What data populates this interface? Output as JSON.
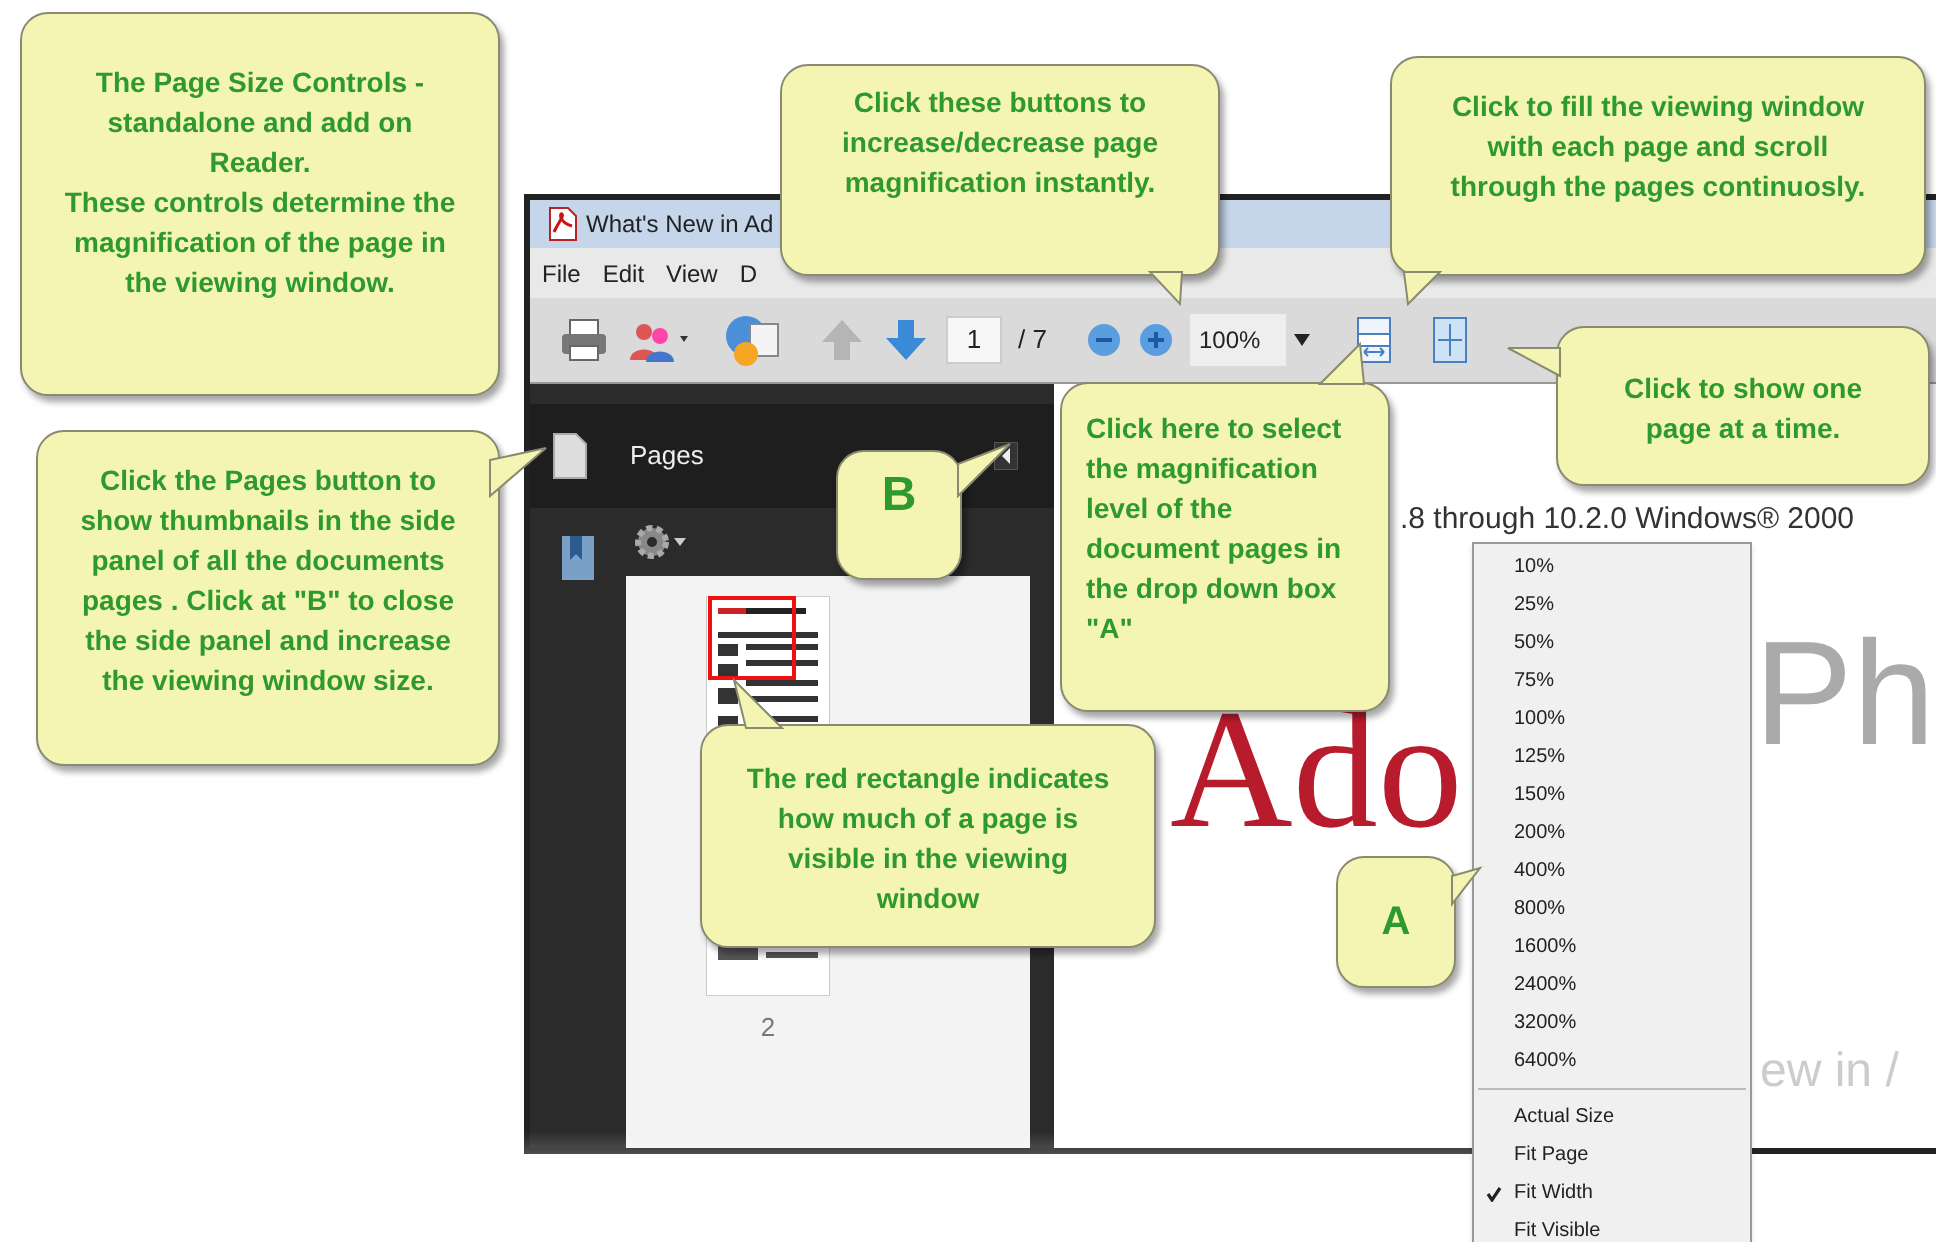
{
  "window": {
    "title": "What's New in Ad"
  },
  "menu_bar": [
    "File",
    "Edit",
    "View",
    "D"
  ],
  "toolbar": {
    "page_number": "1",
    "page_count": "/ 7",
    "zoom": "100%"
  },
  "side_panel": {
    "title": "Pages",
    "thumbnail_label": "2"
  },
  "document": {
    "texts": [
      ".8 through 10.2.0 Windows® 2000",
      "Ado",
      "Ph",
      "ew in /"
    ]
  },
  "zoom_menu": {
    "levels": [
      {
        "label": "10%",
        "checked": false
      },
      {
        "label": "25%",
        "checked": false
      },
      {
        "label": "50%",
        "checked": false
      },
      {
        "label": "75%",
        "checked": false
      },
      {
        "label": "100%",
        "checked": false
      },
      {
        "label": "125%",
        "checked": false
      },
      {
        "label": "150%",
        "checked": false
      },
      {
        "label": "200%",
        "checked": false
      },
      {
        "label": "400%",
        "checked": false
      },
      {
        "label": "800%",
        "checked": false
      },
      {
        "label": "1600%",
        "checked": false
      },
      {
        "label": "2400%",
        "checked": false
      },
      {
        "label": "3200%",
        "checked": false
      },
      {
        "label": "6400%",
        "checked": false
      }
    ],
    "fit_modes": [
      {
        "label": "Actual Size",
        "checked": false
      },
      {
        "label": "Fit Page",
        "checked": false
      },
      {
        "label": "Fit Width",
        "checked": true
      },
      {
        "label": "Fit Visible",
        "checked": false
      }
    ]
  },
  "callouts": [
    {
      "text": "The Page Size Controls - standalone and add on Reader.\nThese controls determine the magnification of the page in the viewing window."
    },
    {
      "text": "Click the Pages button to show thumbnails in the side panel of all the documents pages . Click at \"B\" to close the side panel and increase the viewing window size."
    },
    {
      "text": "Click these buttons to increase/decrease page magnification instantly."
    },
    {
      "text": "Click to fill the viewing window with each page and scroll through the pages continuosly."
    },
    {
      "text": "Click to show one page at a time."
    },
    {
      "text": "Click here to select the magnification level of the document pages in the drop down box \"A\""
    },
    {
      "text": "B"
    },
    {
      "text": "The red rectangle indicates how much of a page is visible in the viewing window"
    },
    {
      "text": "A"
    }
  ]
}
